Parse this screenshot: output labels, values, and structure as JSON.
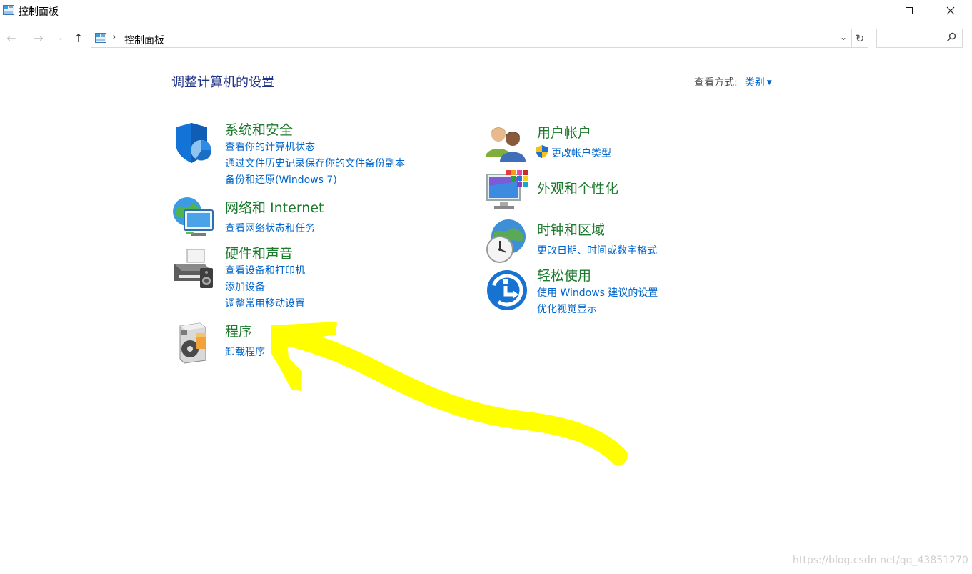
{
  "window": {
    "title": "控制面板",
    "minimize_label": "—",
    "maximize_label": "☐",
    "close_label": "✕"
  },
  "nav": {
    "back_glyph": "←",
    "forward_glyph": "→",
    "recent_glyph": "⌄",
    "up_glyph": "↑",
    "breadcrumb_sep": "›",
    "breadcrumb": "控制面板",
    "dropdown_glyph": "⌄",
    "refresh_glyph": "↻",
    "search_placeholder": "",
    "search_glyph": "⚲"
  },
  "main": {
    "title": "调整计算机的设置",
    "view_by_label": "查看方式:",
    "view_by_value": "类别",
    "view_by_caret": "▼"
  },
  "categories": {
    "system_security": {
      "title": "系统和安全",
      "icon": "shield-icon",
      "links": [
        "查看你的计算机状态",
        "通过文件历史记录保存你的文件备份副本",
        "备份和还原(Windows 7)"
      ]
    },
    "network": {
      "title": "网络和 Internet",
      "icon": "network-globe-icon",
      "links": [
        "查看网络状态和任务"
      ]
    },
    "hardware": {
      "title": "硬件和声音",
      "icon": "printer-icon",
      "links": [
        "查看设备和打印机",
        "添加设备",
        "调整常用移动设置"
      ]
    },
    "programs": {
      "title": "程序",
      "icon": "programs-disc-icon",
      "links": [
        "卸载程序"
      ]
    },
    "user_accounts": {
      "title": "用户帐户",
      "icon": "users-icon",
      "links": [
        "更改帐户类型"
      ]
    },
    "appearance": {
      "title": "外观和个性化",
      "icon": "monitor-palette-icon",
      "links": []
    },
    "clock_region": {
      "title": "时钟和区域",
      "icon": "clock-globe-icon",
      "links": [
        "更改日期、时间或数字格式"
      ]
    },
    "ease_of_access": {
      "title": "轻松使用",
      "icon": "ease-of-access-icon",
      "links": [
        "使用 Windows 建议的设置",
        "优化视觉显示"
      ]
    }
  },
  "annotation": {
    "color": "#ffff00",
    "shape": "hand-drawn-arrow"
  },
  "watermark": "https://blog.csdn.net/qq_43851270"
}
